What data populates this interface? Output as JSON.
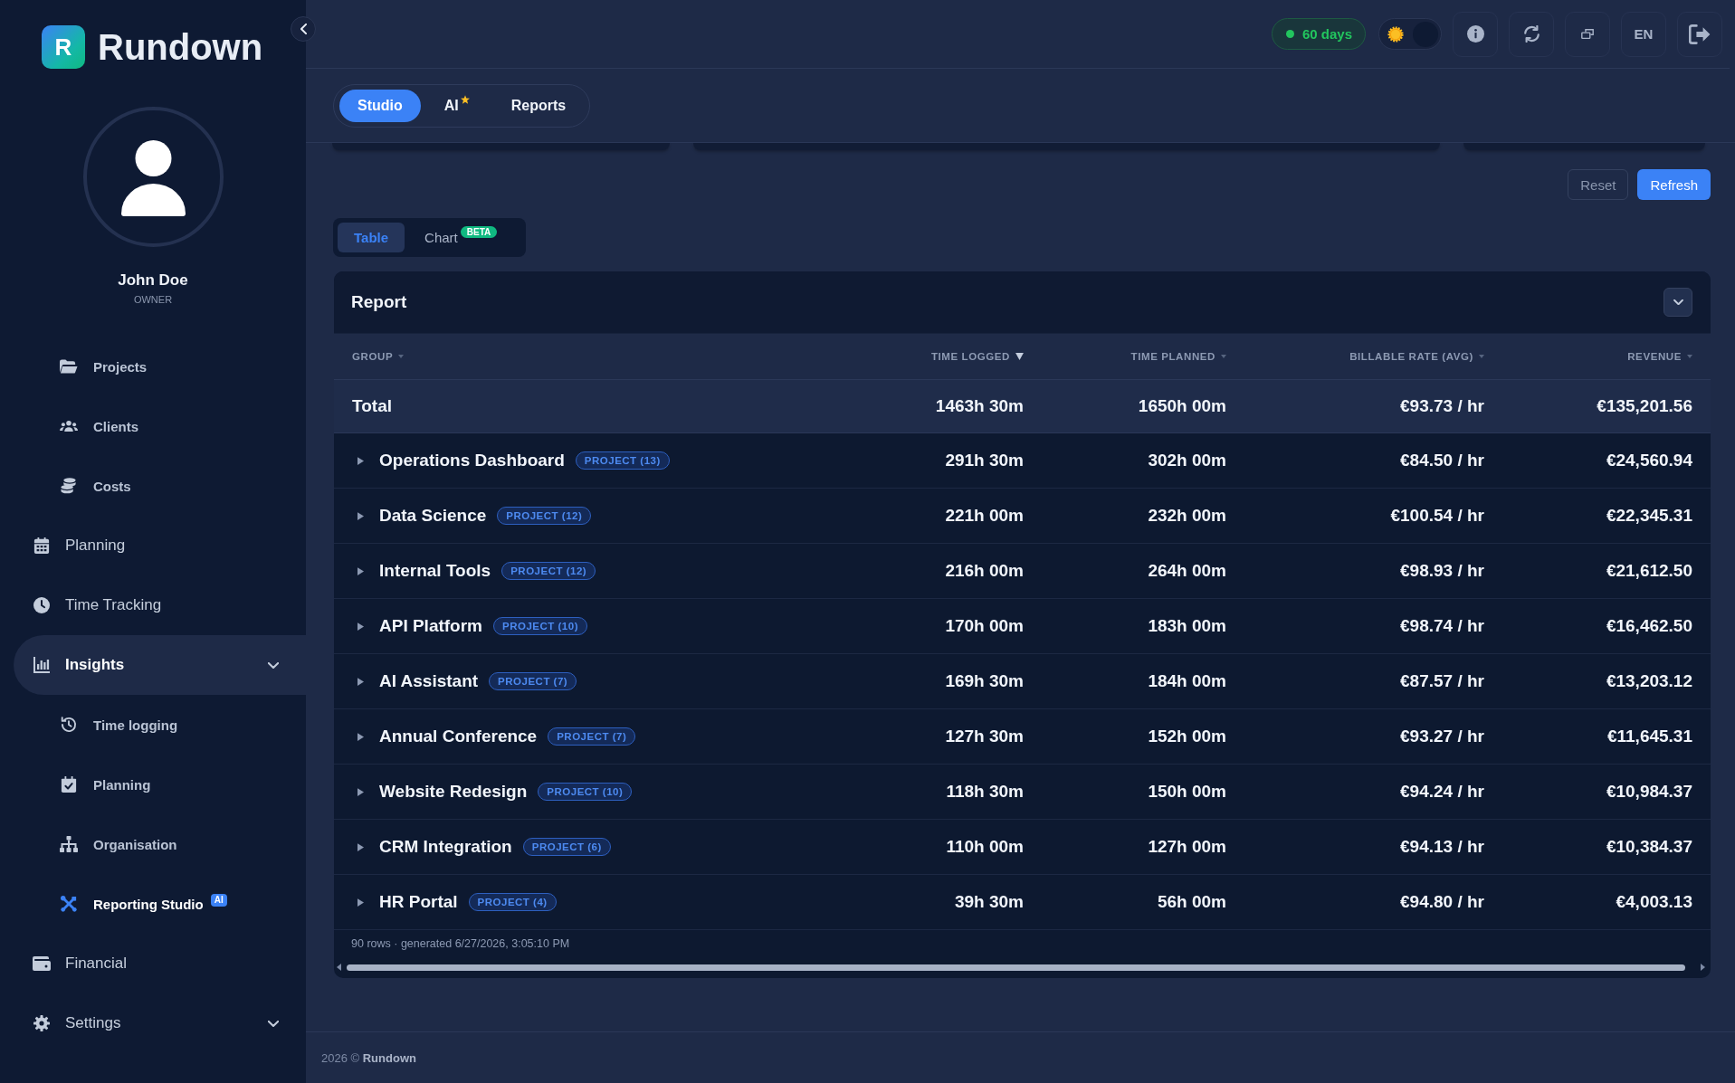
{
  "brand": {
    "logo_letter": "R",
    "name": "Rundown"
  },
  "user": {
    "name": "John Doe",
    "role": "OWNER"
  },
  "sidebar": {
    "top_sub_items": [
      {
        "label": "Projects",
        "selected": false
      },
      {
        "label": "Clients",
        "selected": false
      },
      {
        "label": "Costs",
        "selected": false
      }
    ],
    "items": [
      {
        "label": "Planning",
        "kind": "link",
        "selected": false
      },
      {
        "label": "Time Tracking",
        "kind": "link",
        "selected": false
      },
      {
        "label": "Insights",
        "kind": "group",
        "selected": true,
        "children": [
          {
            "label": "Time logging",
            "selected": false
          },
          {
            "label": "Planning",
            "selected": false
          },
          {
            "label": "Organisation",
            "selected": false
          },
          {
            "label": "Reporting Studio",
            "selected": true,
            "badge": "AI"
          }
        ]
      },
      {
        "label": "Financial",
        "kind": "link",
        "selected": false
      },
      {
        "label": "Settings",
        "kind": "group",
        "selected": false
      }
    ]
  },
  "top_bar": {
    "trial_badge": "60 days",
    "theme_toggle": {
      "dark": true
    },
    "language_button": "EN"
  },
  "tabs": [
    {
      "label": "Studio",
      "selected": true,
      "starred": false
    },
    {
      "label": "AI",
      "selected": false,
      "starred": true
    },
    {
      "label": "Reports",
      "selected": false,
      "starred": false
    }
  ],
  "actions": [
    {
      "label": "Reset",
      "kind": "secondary"
    },
    {
      "label": "Refresh",
      "kind": "primary"
    }
  ],
  "view_switch": [
    {
      "label": "Table",
      "selected": true
    },
    {
      "label": "Chart",
      "selected": false,
      "badge": "BETA"
    }
  ],
  "report": {
    "title": "Report",
    "columns": [
      {
        "label": "GROUP",
        "sorted": false
      },
      {
        "label": "TIME LOGGED",
        "sorted": true
      },
      {
        "label": "TIME PLANNED",
        "sorted": false
      },
      {
        "label": "BILLABLE RATE (AVG)",
        "sorted": false
      },
      {
        "label": "REVENUE",
        "sorted": false
      }
    ],
    "total": {
      "group": "Total",
      "time_logged": "1463h 30m",
      "time_planned": "1650h 00m",
      "billable_rate_avg": "€93.73 / hr",
      "revenue": "€135,201.56"
    },
    "rows": [
      {
        "group": "Operations Dashboard",
        "tag": "PROJECT (13)",
        "expanded": false,
        "time_logged": "291h 30m",
        "time_planned": "302h 00m",
        "billable_rate_avg": "€84.50 / hr",
        "revenue": "€24,560.94"
      },
      {
        "group": "Data Science",
        "tag": "PROJECT (12)",
        "expanded": false,
        "time_logged": "221h 00m",
        "time_planned": "232h 00m",
        "billable_rate_avg": "€100.54 / hr",
        "revenue": "€22,345.31"
      },
      {
        "group": "Internal Tools",
        "tag": "PROJECT (12)",
        "expanded": false,
        "time_logged": "216h 00m",
        "time_planned": "264h 00m",
        "billable_rate_avg": "€98.93 / hr",
        "revenue": "€21,612.50"
      },
      {
        "group": "API Platform",
        "tag": "PROJECT (10)",
        "expanded": false,
        "time_logged": "170h 00m",
        "time_planned": "183h 00m",
        "billable_rate_avg": "€98.74 / hr",
        "revenue": "€16,462.50"
      },
      {
        "group": "AI Assistant",
        "tag": "PROJECT (7)",
        "expanded": false,
        "time_logged": "169h 30m",
        "time_planned": "184h 00m",
        "billable_rate_avg": "€87.57 / hr",
        "revenue": "€13,203.12"
      },
      {
        "group": "Annual Conference",
        "tag": "PROJECT (7)",
        "expanded": false,
        "time_logged": "127h 30m",
        "time_planned": "152h 00m",
        "billable_rate_avg": "€93.27 / hr",
        "revenue": "€11,645.31"
      },
      {
        "group": "Website Redesign",
        "tag": "PROJECT (10)",
        "expanded": false,
        "time_logged": "118h 30m",
        "time_planned": "150h 00m",
        "billable_rate_avg": "€94.24 / hr",
        "revenue": "€10,984.37"
      },
      {
        "group": "CRM Integration",
        "tag": "PROJECT (6)",
        "expanded": false,
        "time_logged": "110h 00m",
        "time_planned": "127h 00m",
        "billable_rate_avg": "€94.13 / hr",
        "revenue": "€10,384.37"
      },
      {
        "group": "HR Portal",
        "tag": "PROJECT (4)",
        "expanded": false,
        "time_logged": "39h 30m",
        "time_planned": "56h 00m",
        "billable_rate_avg": "€94.80 / hr",
        "revenue": "€4,003.13"
      }
    ],
    "footer": "90 rows · generated 6/27/2026, 3:05:10 PM"
  },
  "footer": "2026 © **Rundown**"
}
